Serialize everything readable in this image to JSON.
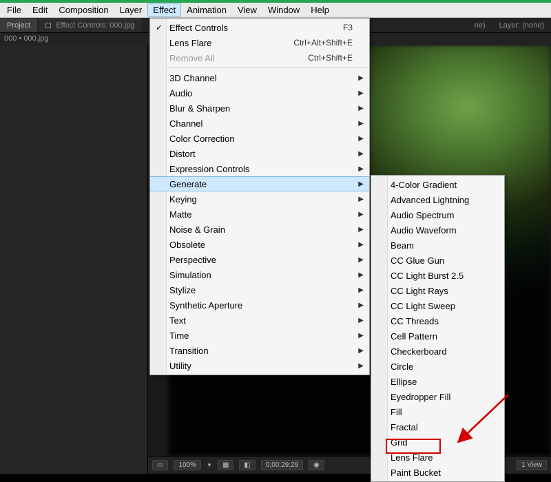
{
  "menubar": {
    "items": [
      "File",
      "Edit",
      "Composition",
      "Layer",
      "Effect",
      "Animation",
      "View",
      "Window",
      "Help"
    ],
    "open_index": 4
  },
  "tabs": {
    "project": "Project",
    "effect_controls": "Effect Controls: 000.jpg",
    "right_a": "ne)",
    "right_b": "Layer: (none)"
  },
  "infoline": "000 • 000.jpg",
  "effect_menu": {
    "top": [
      {
        "label": "Effect Controls",
        "shortcut": "F3",
        "checked": true
      },
      {
        "label": "Lens Flare",
        "shortcut": "Ctrl+Alt+Shift+E"
      },
      {
        "label": "Remove All",
        "shortcut": "Ctrl+Shift+E",
        "disabled": true
      }
    ],
    "groups": [
      "3D Channel",
      "Audio",
      "Blur & Sharpen",
      "Channel",
      "Color Correction",
      "Distort",
      "Expression Controls",
      "Generate",
      "Keying",
      "Matte",
      "Noise & Grain",
      "Obsolete",
      "Perspective",
      "Simulation",
      "Stylize",
      "Synthetic Aperture",
      "Text",
      "Time",
      "Transition",
      "Utility"
    ],
    "highlight_index": 7
  },
  "generate_submenu": [
    "4-Color Gradient",
    "Advanced Lightning",
    "Audio Spectrum",
    "Audio Waveform",
    "Beam",
    "CC Glue Gun",
    "CC Light Burst 2.5",
    "CC Light Rays",
    "CC Light Sweep",
    "CC Threads",
    "Cell Pattern",
    "Checkerboard",
    "Circle",
    "Ellipse",
    "Eyedropper Fill",
    "Fill",
    "Fractal",
    "Grid",
    "Lens Flare",
    "Paint Bucket"
  ],
  "viewer_bar": {
    "zoom": "100%",
    "timecode": "0;00;29;29",
    "view_label": "1 View"
  }
}
